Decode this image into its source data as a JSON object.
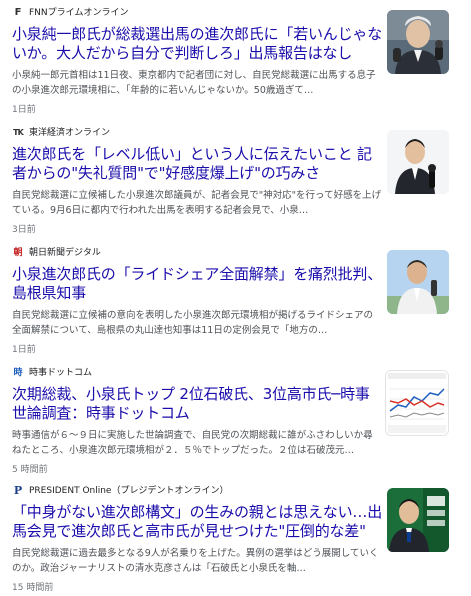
{
  "articles": [
    {
      "source": "FNNプライムオンライン",
      "source_logo": "F",
      "title": "小泉純一郎氏が総裁選出馬の進次郎氏に「若いんじゃないか。大人だから自分で判断しろ」出馬報告はなし",
      "snippet": "小泉純一郎元首相は11日夜、東京都内で記者団に対し、自民党総裁選に出馬する息子の小泉進次郎元環境相に、「年齢的に若いんじゃないか。50歳過ぎて…",
      "time": "1日前",
      "thumb_icon": "elderly-man-speaking-photo"
    },
    {
      "source": "東洋経済オンライン",
      "source_logo": "TK",
      "title": "進次郎氏を「レベル低い」という人に伝えたいこと 記者からの\"失礼質問\"で\"好感度爆上げ\"の巧みさ",
      "snippet": "自民党総裁選に立候補した小泉進次郎議員が、記者会見で\"神対応\"を行って好感を上げている。9月6日に都内で行われた出馬を表明する記者会見で、小泉…",
      "time": "3日前",
      "thumb_icon": "speaker-at-press-conference-photo"
    },
    {
      "source": "朝日新聞デジタル",
      "source_logo": "朝",
      "title": "小泉進次郎氏の「ライドシェア全面解禁」を痛烈批判、島根県知事",
      "snippet": "自民党総裁選に立候補の意向を表明した小泉進次郎元環境相が掲げるライドシェアの全面解禁について、島根県の丸山達也知事は11日の定例会見で「地方の…",
      "time": "1日前",
      "thumb_icon": "governor-press-conference-photo"
    },
    {
      "source": "時事ドットコム",
      "source_logo": "時",
      "title": "次期総裁、小泉氏トップ 2位石破氏、3位高市氏─時事世論調査：時事ドットコム",
      "snippet": "時事通信が６～９日に実施した世論調査で、自民党の次期総裁に誰がふさわしいか尋ねたところ、小泉進次郎元環境相が２．５％でトップだった。２位は石破茂元…",
      "time": "5 時間前",
      "thumb_icon": "poll-line-chart-image"
    },
    {
      "source": "PRESIDENT Online（プレジデントオンライン）",
      "source_logo": "P",
      "title": "「中身がない進次郎構文」の生みの親とは思えない…出馬会見で進次郎氏と高市氏が見せつけた\"圧倒的な差\"",
      "snippet": "自民党総裁選に過去最多となる9人が名乗りを上げた。異例の選挙はどう展開していくのか。政治ジャーナリストの清水克彦さんは「石破氏と小泉氏を軸…",
      "time": "15 時間前",
      "thumb_icon": "candidate-announcement-photo"
    }
  ],
  "colors": {
    "headline": "#1a0dab",
    "snippet": "#4d5156",
    "meta": "#70757a",
    "jiji_logo": "#1f5fbf",
    "asahi_logo": "#c41f1f",
    "president_logo": "#1e3f8c"
  }
}
